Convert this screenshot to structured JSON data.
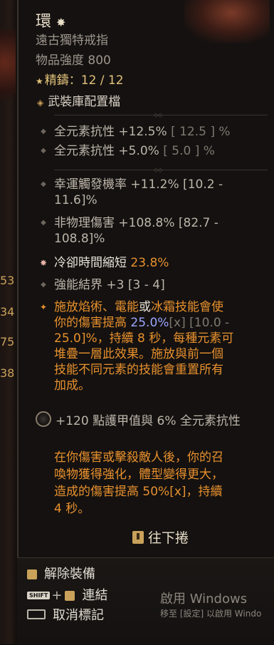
{
  "side_numbers": [
    "53",
    "34",
    "75",
    "38"
  ],
  "item": {
    "title": "環",
    "type": "遠古獨特戒指",
    "power": "物品強度 800",
    "masterwork": "精鑄：12 / 12",
    "armory": "武裝庫配置檔"
  },
  "implicits": [
    {
      "prefix": "全元素抗性 +12.5%",
      "range": "[ 12.5 ] %"
    },
    {
      "prefix": "全元素抗性 +5.0%",
      "range": "[ 5.0 ] %"
    }
  ],
  "affixes": [
    {
      "line1": "幸運觸發機率 +11.2% [10.2 -",
      "line2": "11.6]%"
    },
    {
      "line1": "非物理傷害 +108.8% [82.7 -",
      "line2": "108.8]%"
    },
    {
      "label": "冷卻時間縮短",
      "value": "23.8%"
    },
    {
      "line1": "強能結界 +3 [3 - 4]"
    }
  ],
  "unique_power": {
    "l1a": "施放焰術、電能",
    "l1b": "或",
    "l1c": "冰霜",
    "l1d": "技能會使",
    "l2a": "你的傷害提高 ",
    "l2b": "25.0%",
    "l2c": "[x] [10.0 -",
    "l3": "25.0]%，持續 8 秒，每種元素可",
    "l4": "堆疊一層此效果。施放與前一個",
    "l5": "技能不同元素的技能會重置所有",
    "l6": "加成。"
  },
  "paragon": "+120 點護甲值與 6% 全元素抗性",
  "flavor": {
    "l1": "在你傷害或擊殺敵人後，你的召",
    "l2": "喚物獲得強化，體型變得更大，",
    "l3a": "造成的傷害提高 50%",
    "l3b": "[x]",
    "l3c": "，持續",
    "l4": "4 秒。"
  },
  "scroll_hint": "往下捲",
  "actions": {
    "unequip": "解除裝備",
    "shift_key": "SHIFT",
    "link": "連結",
    "unmark": "取消標記"
  },
  "windows": {
    "title": "啟用 Windows",
    "subtitle": "移至 [設定] 以啟用 Windo"
  }
}
